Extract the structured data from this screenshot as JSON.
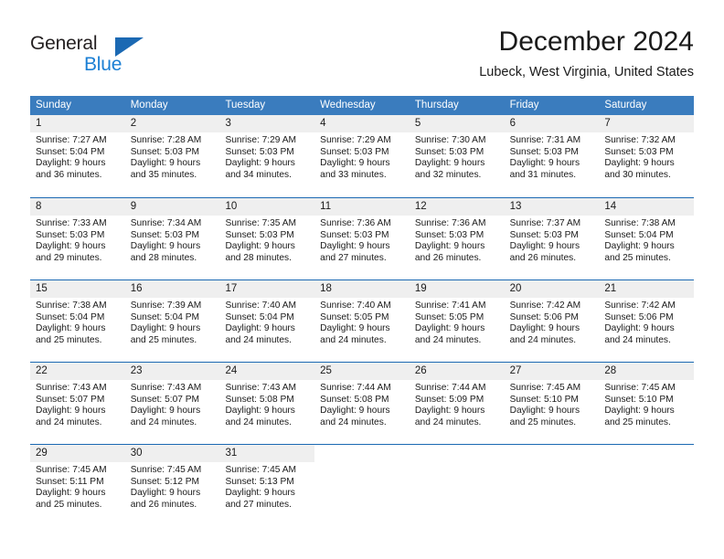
{
  "brand": {
    "name_top": "General",
    "name_bottom": "Blue",
    "accent_color": "#1b69b3",
    "blue_text_color": "#1b7fd4"
  },
  "header": {
    "title": "December 2024",
    "location": "Lubeck, West Virginia, United States"
  },
  "theme": {
    "header_bar_color": "#3a7cbe",
    "week_separator_color": "#1b69b3",
    "day_number_bg": "#efefef",
    "text_color": "#1a1a1a"
  },
  "weekdays": [
    "Sunday",
    "Monday",
    "Tuesday",
    "Wednesday",
    "Thursday",
    "Friday",
    "Saturday"
  ],
  "weeks": [
    [
      {
        "date": "1",
        "sunrise": "Sunrise: 7:27 AM",
        "sunset": "Sunset: 5:04 PM",
        "daylight_line1": "Daylight: 9 hours",
        "daylight_line2": "and 36 minutes."
      },
      {
        "date": "2",
        "sunrise": "Sunrise: 7:28 AM",
        "sunset": "Sunset: 5:03 PM",
        "daylight_line1": "Daylight: 9 hours",
        "daylight_line2": "and 35 minutes."
      },
      {
        "date": "3",
        "sunrise": "Sunrise: 7:29 AM",
        "sunset": "Sunset: 5:03 PM",
        "daylight_line1": "Daylight: 9 hours",
        "daylight_line2": "and 34 minutes."
      },
      {
        "date": "4",
        "sunrise": "Sunrise: 7:29 AM",
        "sunset": "Sunset: 5:03 PM",
        "daylight_line1": "Daylight: 9 hours",
        "daylight_line2": "and 33 minutes."
      },
      {
        "date": "5",
        "sunrise": "Sunrise: 7:30 AM",
        "sunset": "Sunset: 5:03 PM",
        "daylight_line1": "Daylight: 9 hours",
        "daylight_line2": "and 32 minutes."
      },
      {
        "date": "6",
        "sunrise": "Sunrise: 7:31 AM",
        "sunset": "Sunset: 5:03 PM",
        "daylight_line1": "Daylight: 9 hours",
        "daylight_line2": "and 31 minutes."
      },
      {
        "date": "7",
        "sunrise": "Sunrise: 7:32 AM",
        "sunset": "Sunset: 5:03 PM",
        "daylight_line1": "Daylight: 9 hours",
        "daylight_line2": "and 30 minutes."
      }
    ],
    [
      {
        "date": "8",
        "sunrise": "Sunrise: 7:33 AM",
        "sunset": "Sunset: 5:03 PM",
        "daylight_line1": "Daylight: 9 hours",
        "daylight_line2": "and 29 minutes."
      },
      {
        "date": "9",
        "sunrise": "Sunrise: 7:34 AM",
        "sunset": "Sunset: 5:03 PM",
        "daylight_line1": "Daylight: 9 hours",
        "daylight_line2": "and 28 minutes."
      },
      {
        "date": "10",
        "sunrise": "Sunrise: 7:35 AM",
        "sunset": "Sunset: 5:03 PM",
        "daylight_line1": "Daylight: 9 hours",
        "daylight_line2": "and 28 minutes."
      },
      {
        "date": "11",
        "sunrise": "Sunrise: 7:36 AM",
        "sunset": "Sunset: 5:03 PM",
        "daylight_line1": "Daylight: 9 hours",
        "daylight_line2": "and 27 minutes."
      },
      {
        "date": "12",
        "sunrise": "Sunrise: 7:36 AM",
        "sunset": "Sunset: 5:03 PM",
        "daylight_line1": "Daylight: 9 hours",
        "daylight_line2": "and 26 minutes."
      },
      {
        "date": "13",
        "sunrise": "Sunrise: 7:37 AM",
        "sunset": "Sunset: 5:03 PM",
        "daylight_line1": "Daylight: 9 hours",
        "daylight_line2": "and 26 minutes."
      },
      {
        "date": "14",
        "sunrise": "Sunrise: 7:38 AM",
        "sunset": "Sunset: 5:04 PM",
        "daylight_line1": "Daylight: 9 hours",
        "daylight_line2": "and 25 minutes."
      }
    ],
    [
      {
        "date": "15",
        "sunrise": "Sunrise: 7:38 AM",
        "sunset": "Sunset: 5:04 PM",
        "daylight_line1": "Daylight: 9 hours",
        "daylight_line2": "and 25 minutes."
      },
      {
        "date": "16",
        "sunrise": "Sunrise: 7:39 AM",
        "sunset": "Sunset: 5:04 PM",
        "daylight_line1": "Daylight: 9 hours",
        "daylight_line2": "and 25 minutes."
      },
      {
        "date": "17",
        "sunrise": "Sunrise: 7:40 AM",
        "sunset": "Sunset: 5:04 PM",
        "daylight_line1": "Daylight: 9 hours",
        "daylight_line2": "and 24 minutes."
      },
      {
        "date": "18",
        "sunrise": "Sunrise: 7:40 AM",
        "sunset": "Sunset: 5:05 PM",
        "daylight_line1": "Daylight: 9 hours",
        "daylight_line2": "and 24 minutes."
      },
      {
        "date": "19",
        "sunrise": "Sunrise: 7:41 AM",
        "sunset": "Sunset: 5:05 PM",
        "daylight_line1": "Daylight: 9 hours",
        "daylight_line2": "and 24 minutes."
      },
      {
        "date": "20",
        "sunrise": "Sunrise: 7:42 AM",
        "sunset": "Sunset: 5:06 PM",
        "daylight_line1": "Daylight: 9 hours",
        "daylight_line2": "and 24 minutes."
      },
      {
        "date": "21",
        "sunrise": "Sunrise: 7:42 AM",
        "sunset": "Sunset: 5:06 PM",
        "daylight_line1": "Daylight: 9 hours",
        "daylight_line2": "and 24 minutes."
      }
    ],
    [
      {
        "date": "22",
        "sunrise": "Sunrise: 7:43 AM",
        "sunset": "Sunset: 5:07 PM",
        "daylight_line1": "Daylight: 9 hours",
        "daylight_line2": "and 24 minutes."
      },
      {
        "date": "23",
        "sunrise": "Sunrise: 7:43 AM",
        "sunset": "Sunset: 5:07 PM",
        "daylight_line1": "Daylight: 9 hours",
        "daylight_line2": "and 24 minutes."
      },
      {
        "date": "24",
        "sunrise": "Sunrise: 7:43 AM",
        "sunset": "Sunset: 5:08 PM",
        "daylight_line1": "Daylight: 9 hours",
        "daylight_line2": "and 24 minutes."
      },
      {
        "date": "25",
        "sunrise": "Sunrise: 7:44 AM",
        "sunset": "Sunset: 5:08 PM",
        "daylight_line1": "Daylight: 9 hours",
        "daylight_line2": "and 24 minutes."
      },
      {
        "date": "26",
        "sunrise": "Sunrise: 7:44 AM",
        "sunset": "Sunset: 5:09 PM",
        "daylight_line1": "Daylight: 9 hours",
        "daylight_line2": "and 24 minutes."
      },
      {
        "date": "27",
        "sunrise": "Sunrise: 7:45 AM",
        "sunset": "Sunset: 5:10 PM",
        "daylight_line1": "Daylight: 9 hours",
        "daylight_line2": "and 25 minutes."
      },
      {
        "date": "28",
        "sunrise": "Sunrise: 7:45 AM",
        "sunset": "Sunset: 5:10 PM",
        "daylight_line1": "Daylight: 9 hours",
        "daylight_line2": "and 25 minutes."
      }
    ],
    [
      {
        "date": "29",
        "sunrise": "Sunrise: 7:45 AM",
        "sunset": "Sunset: 5:11 PM",
        "daylight_line1": "Daylight: 9 hours",
        "daylight_line2": "and 25 minutes."
      },
      {
        "date": "30",
        "sunrise": "Sunrise: 7:45 AM",
        "sunset": "Sunset: 5:12 PM",
        "daylight_line1": "Daylight: 9 hours",
        "daylight_line2": "and 26 minutes."
      },
      {
        "date": "31",
        "sunrise": "Sunrise: 7:45 AM",
        "sunset": "Sunset: 5:13 PM",
        "daylight_line1": "Daylight: 9 hours",
        "daylight_line2": "and 27 minutes."
      },
      {
        "date": "",
        "sunrise": "",
        "sunset": "",
        "daylight_line1": "",
        "daylight_line2": ""
      },
      {
        "date": "",
        "sunrise": "",
        "sunset": "",
        "daylight_line1": "",
        "daylight_line2": ""
      },
      {
        "date": "",
        "sunrise": "",
        "sunset": "",
        "daylight_line1": "",
        "daylight_line2": ""
      },
      {
        "date": "",
        "sunrise": "",
        "sunset": "",
        "daylight_line1": "",
        "daylight_line2": ""
      }
    ]
  ]
}
